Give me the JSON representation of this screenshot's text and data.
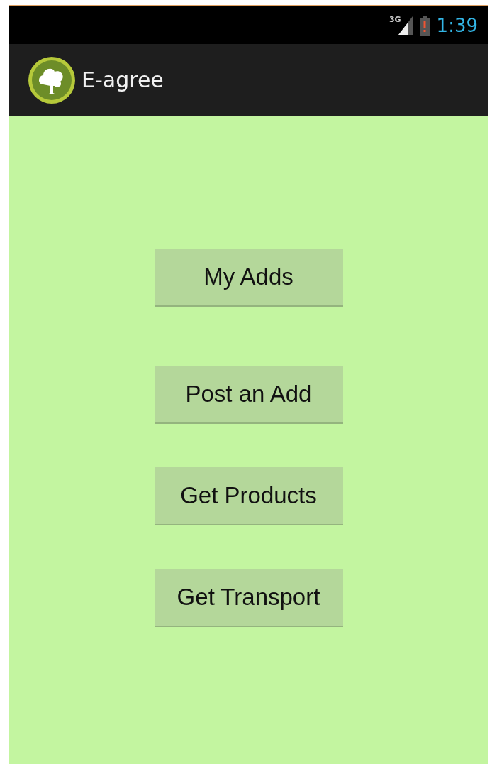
{
  "status_bar": {
    "network": "3G",
    "time": "1:39"
  },
  "action_bar": {
    "title": "E-agree"
  },
  "buttons": [
    {
      "label": "My Adds"
    },
    {
      "label": "Post an Add"
    },
    {
      "label": "Get Products"
    },
    {
      "label": "Get Transport"
    }
  ]
}
